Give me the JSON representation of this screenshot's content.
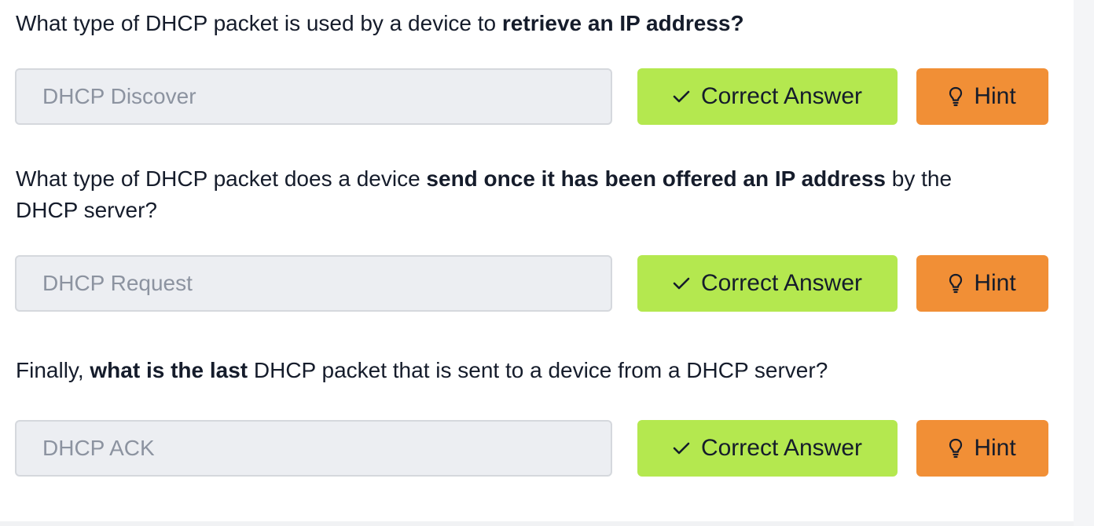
{
  "questions": [
    {
      "prompt_parts": [
        {
          "text": "What type of DHCP packet is used by a device to ",
          "bold": false
        },
        {
          "text": "retrieve an IP address?",
          "bold": true
        }
      ],
      "answer_value": "DHCP Discover"
    },
    {
      "prompt_parts": [
        {
          "text": "What type of DHCP packet does a device ",
          "bold": false
        },
        {
          "text": "send once it has been offered an IP address",
          "bold": true
        },
        {
          "text": " by the DHCP server?",
          "bold": false
        }
      ],
      "answer_value": "DHCP Request"
    },
    {
      "prompt_parts": [
        {
          "text": "Finally, ",
          "bold": false
        },
        {
          "text": "what is the last",
          "bold": true
        },
        {
          "text": " DHCP packet that is sent to a device from a DHCP server?",
          "bold": false
        }
      ],
      "answer_value": "DHCP ACK"
    }
  ],
  "buttons": {
    "correct_label": "Correct Answer",
    "correct_icon": "check-icon",
    "hint_label": "Hint",
    "hint_icon": "lightbulb-icon"
  },
  "colors": {
    "correct_bg": "#b4e84f",
    "hint_bg": "#f18f36",
    "field_bg": "#eceef2",
    "text": "#151c2b",
    "answer_text": "#8c93a0"
  }
}
